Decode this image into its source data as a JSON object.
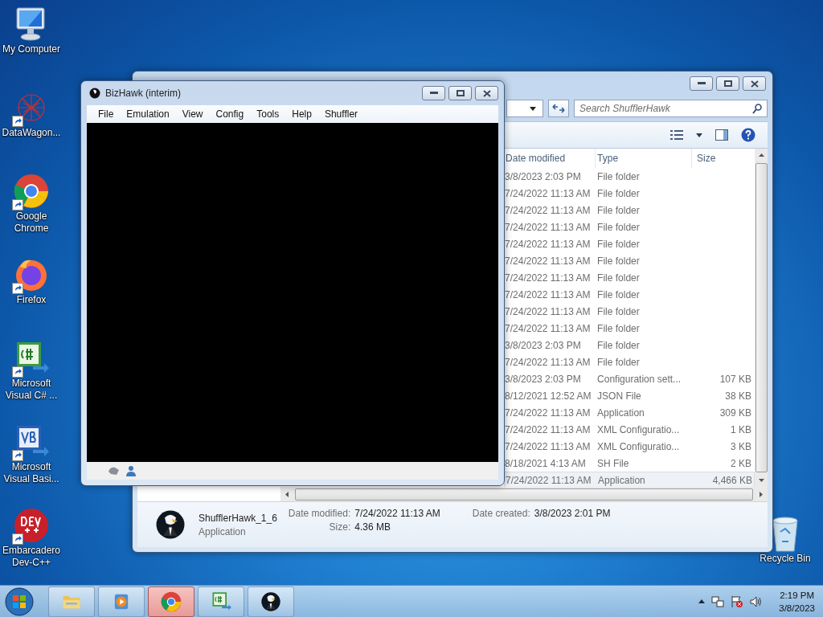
{
  "desktop_icons": [
    {
      "kind": "computer",
      "label": "My Computer",
      "shortcut": false
    },
    {
      "kind": "network",
      "label": "DataWagon...",
      "shortcut": true
    },
    {
      "kind": "chrome",
      "label": "Google Chrome",
      "shortcut": true
    },
    {
      "kind": "firefox",
      "label": "Firefox",
      "shortcut": true
    },
    {
      "kind": "csharp",
      "label": "Microsoft Visual C# ...",
      "shortcut": true
    },
    {
      "kind": "vb",
      "label": "Microsoft Visual Basi...",
      "shortcut": true
    },
    {
      "kind": "devcpp",
      "label": "Embarcadero Dev-C++",
      "shortcut": true
    }
  ],
  "recycle_bin": {
    "label": "Recycle Bin"
  },
  "explorer": {
    "search": {
      "placeholder": "Search ShufflerHawk"
    },
    "columns": [
      "Date modified",
      "Type",
      "Size"
    ],
    "rows": [
      {
        "date": "3/8/2023 2:03 PM",
        "type": "File folder",
        "selected": false
      },
      {
        "date": "7/24/2022 11:13 AM",
        "type": "File folder",
        "selected": false
      },
      {
        "date": "7/24/2022 11:13 AM",
        "type": "File folder",
        "selected": false
      },
      {
        "date": "7/24/2022 11:13 AM",
        "type": "File folder",
        "selected": false
      },
      {
        "date": "7/24/2022 11:13 AM",
        "type": "File folder",
        "selected": false
      },
      {
        "date": "7/24/2022 11:13 AM",
        "type": "File folder",
        "selected": false
      },
      {
        "date": "7/24/2022 11:13 AM",
        "type": "File folder",
        "selected": false
      },
      {
        "date": "7/24/2022 11:13 AM",
        "type": "File folder",
        "selected": false
      },
      {
        "date": "7/24/2022 11:13 AM",
        "type": "File folder",
        "selected": false
      },
      {
        "date": "7/24/2022 11:13 AM",
        "type": "File folder",
        "selected": false
      },
      {
        "date": "3/8/2023 2:03 PM",
        "type": "File folder",
        "selected": false
      },
      {
        "date": "7/24/2022 11:13 AM",
        "type": "File folder",
        "selected": false
      },
      {
        "date": "3/8/2023 2:03 PM",
        "type": "Configuration sett...",
        "size": "107 KB",
        "selected": false
      },
      {
        "date": "8/12/2021 12:52 AM",
        "type": "JSON File",
        "size": "38 KB",
        "selected": false
      },
      {
        "date": "7/24/2022 11:13 AM",
        "type": "Application",
        "size": "309 KB",
        "selected": false
      },
      {
        "date": "7/24/2022 11:13 AM",
        "type": "XML Configuratio...",
        "size": "1 KB",
        "selected": false
      },
      {
        "date": "7/24/2022 11:13 AM",
        "type": "XML Configuratio...",
        "size": "3 KB",
        "selected": false
      },
      {
        "date": "8/18/2021 4:13 AM",
        "type": "SH File",
        "size": "2 KB",
        "selected": false
      },
      {
        "date": "7/24/2022 11:13 AM",
        "type": "Application",
        "size": "4,466 KB",
        "selected": true
      }
    ],
    "details": {
      "name": "ShufflerHawk_1_6",
      "type": "Application",
      "date_modified_label": "Date modified:",
      "date_modified": "7/24/2022 11:13 AM",
      "size_label": "Size:",
      "size": "4.36 MB",
      "date_created_label": "Date created:",
      "date_created": "3/8/2023 2:01 PM"
    }
  },
  "bizhawk": {
    "title": "BizHawk (interim)",
    "menu": [
      "File",
      "Emulation",
      "View",
      "Config",
      "Tools",
      "Help",
      "Shuffler"
    ]
  },
  "taskbar": {
    "buttons": [
      {
        "kind": "explorer",
        "selected": false
      },
      {
        "kind": "media",
        "selected": false
      },
      {
        "kind": "chrome",
        "selected": true
      },
      {
        "kind": "csharp",
        "selected": false
      },
      {
        "kind": "hawk",
        "selected": false
      }
    ],
    "clock": {
      "time": "2:19 PM",
      "date": "3/8/2023"
    }
  }
}
